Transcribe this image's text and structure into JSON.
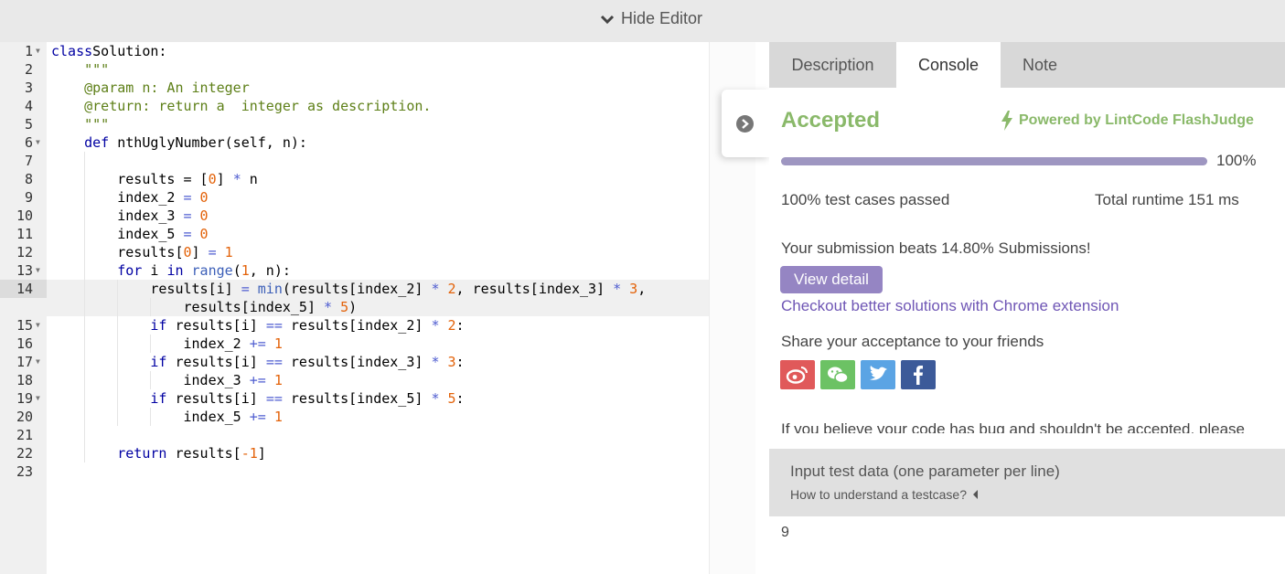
{
  "topbar": {
    "hide_editor_label": "Hide Editor"
  },
  "editor": {
    "active_line": 14,
    "lines": [
      {
        "n": "1",
        "fold": true
      },
      {
        "n": "2",
        "fold": false
      },
      {
        "n": "3",
        "fold": false
      },
      {
        "n": "4",
        "fold": false
      },
      {
        "n": "5",
        "fold": false
      },
      {
        "n": "6",
        "fold": true
      },
      {
        "n": "7",
        "fold": false
      },
      {
        "n": "8",
        "fold": false
      },
      {
        "n": "9",
        "fold": false
      },
      {
        "n": "10",
        "fold": false
      },
      {
        "n": "11",
        "fold": false
      },
      {
        "n": "12",
        "fold": false
      },
      {
        "n": "13",
        "fold": true
      },
      {
        "n": "14",
        "fold": false
      },
      {
        "n": "",
        "fold": false
      },
      {
        "n": "15",
        "fold": true
      },
      {
        "n": "16",
        "fold": false
      },
      {
        "n": "17",
        "fold": true
      },
      {
        "n": "18",
        "fold": false
      },
      {
        "n": "19",
        "fold": true
      },
      {
        "n": "20",
        "fold": false
      },
      {
        "n": "21",
        "fold": false
      },
      {
        "n": "22",
        "fold": false
      },
      {
        "n": "23",
        "fold": false
      }
    ],
    "code": [
      [
        [
          "kw",
          "class"
        ],
        [
          "",
          "Solution:"
        ]
      ],
      [
        [
          "str",
          "    \"\"\""
        ]
      ],
      [
        [
          "str",
          "    @param n: An integer"
        ]
      ],
      [
        [
          "str",
          "    @return: return a  integer as description."
        ]
      ],
      [
        [
          "str",
          "    \"\"\""
        ]
      ],
      [
        [
          "kw",
          "    def "
        ],
        [
          "",
          "nthUglyNumber(self, n):"
        ]
      ],
      [],
      [
        [
          "",
          "        results = ["
        ],
        [
          "num",
          "0"
        ],
        [
          "",
          "] "
        ],
        [
          "op",
          "*"
        ],
        [
          "",
          " n"
        ]
      ],
      [
        [
          "",
          "        index_2 "
        ],
        [
          "op",
          "="
        ],
        [
          "num",
          " 0"
        ]
      ],
      [
        [
          "",
          "        index_3 "
        ],
        [
          "op",
          "="
        ],
        [
          "num",
          " 0"
        ]
      ],
      [
        [
          "",
          "        index_5 "
        ],
        [
          "op",
          "="
        ],
        [
          "num",
          " 0"
        ]
      ],
      [
        [
          "",
          "        results["
        ],
        [
          "num",
          "0"
        ],
        [
          "",
          "] "
        ],
        [
          "op",
          "="
        ],
        [
          "num",
          " 1"
        ]
      ],
      [
        [
          "kw",
          "        for "
        ],
        [
          "",
          "i "
        ],
        [
          "kw",
          "in "
        ],
        [
          "fn",
          "range"
        ],
        [
          "",
          "("
        ],
        [
          "num",
          "1"
        ],
        [
          "",
          ", n):"
        ]
      ],
      [
        [
          "",
          "            results[i] "
        ],
        [
          "op",
          "="
        ],
        [
          "fn",
          " min"
        ],
        [
          "",
          "(results[index_2] "
        ],
        [
          "op",
          "*"
        ],
        [
          "num",
          " 2"
        ],
        [
          "",
          ", results[index_3] "
        ],
        [
          "op",
          "*"
        ],
        [
          "num",
          " 3"
        ],
        [
          "",
          ","
        ]
      ],
      [
        [
          "",
          "                results[index_5] "
        ],
        [
          "op",
          "*"
        ],
        [
          "num",
          " 5"
        ],
        [
          "",
          ")"
        ]
      ],
      [
        [
          "kw",
          "            if "
        ],
        [
          "",
          "results[i] "
        ],
        [
          "op",
          "=="
        ],
        [
          "",
          " results[index_2] "
        ],
        [
          "op",
          "*"
        ],
        [
          "num",
          " 2"
        ],
        [
          "",
          ":"
        ]
      ],
      [
        [
          "",
          "                index_2 "
        ],
        [
          "op",
          "+="
        ],
        [
          "num",
          " 1"
        ]
      ],
      [
        [
          "kw",
          "            if "
        ],
        [
          "",
          "results[i] "
        ],
        [
          "op",
          "=="
        ],
        [
          "",
          " results[index_3] "
        ],
        [
          "op",
          "*"
        ],
        [
          "num",
          " 3"
        ],
        [
          "",
          ":"
        ]
      ],
      [
        [
          "",
          "                index_3 "
        ],
        [
          "op",
          "+="
        ],
        [
          "num",
          " 1"
        ]
      ],
      [
        [
          "kw",
          "            if "
        ],
        [
          "",
          "results[i] "
        ],
        [
          "op",
          "=="
        ],
        [
          "",
          " results[index_5] "
        ],
        [
          "op",
          "*"
        ],
        [
          "num",
          " 5"
        ],
        [
          "",
          ":"
        ]
      ],
      [
        [
          "",
          "                index_5 "
        ],
        [
          "op",
          "+="
        ],
        [
          "num",
          " 1"
        ]
      ],
      [],
      [
        [
          "kw",
          "        return "
        ],
        [
          "",
          "results["
        ],
        [
          "num",
          "-1"
        ],
        [
          "",
          "]"
        ]
      ],
      []
    ]
  },
  "panel": {
    "tabs": [
      {
        "label": "Description",
        "active": false
      },
      {
        "label": "Console",
        "active": true
      },
      {
        "label": "Note",
        "active": false
      }
    ],
    "status": "Accepted",
    "powered_by": "Powered by LintCode FlashJudge",
    "progress_percent": 100,
    "progress_label": "100%",
    "tests_passed": "100% test cases passed",
    "runtime": "Total runtime 151 ms",
    "beats": "Your submission beats 14.80% Submissions!",
    "view_detail": "View detail",
    "checkout": "Checkout better solutions with Chrome extension",
    "share": "Share your acceptance to your friends",
    "social": [
      "weibo",
      "wechat",
      "twitter",
      "facebook"
    ],
    "believe": "If you believe your code has bug and shouldn't be accepted, please",
    "input_title": "Input test data (one parameter per line)",
    "input_help": "How to understand a testcase?",
    "input_value": "9"
  },
  "colors": {
    "accepted": "#8ab96a",
    "progress": "#9e96c1",
    "button": "#9585c3",
    "link": "#6f56b5"
  }
}
